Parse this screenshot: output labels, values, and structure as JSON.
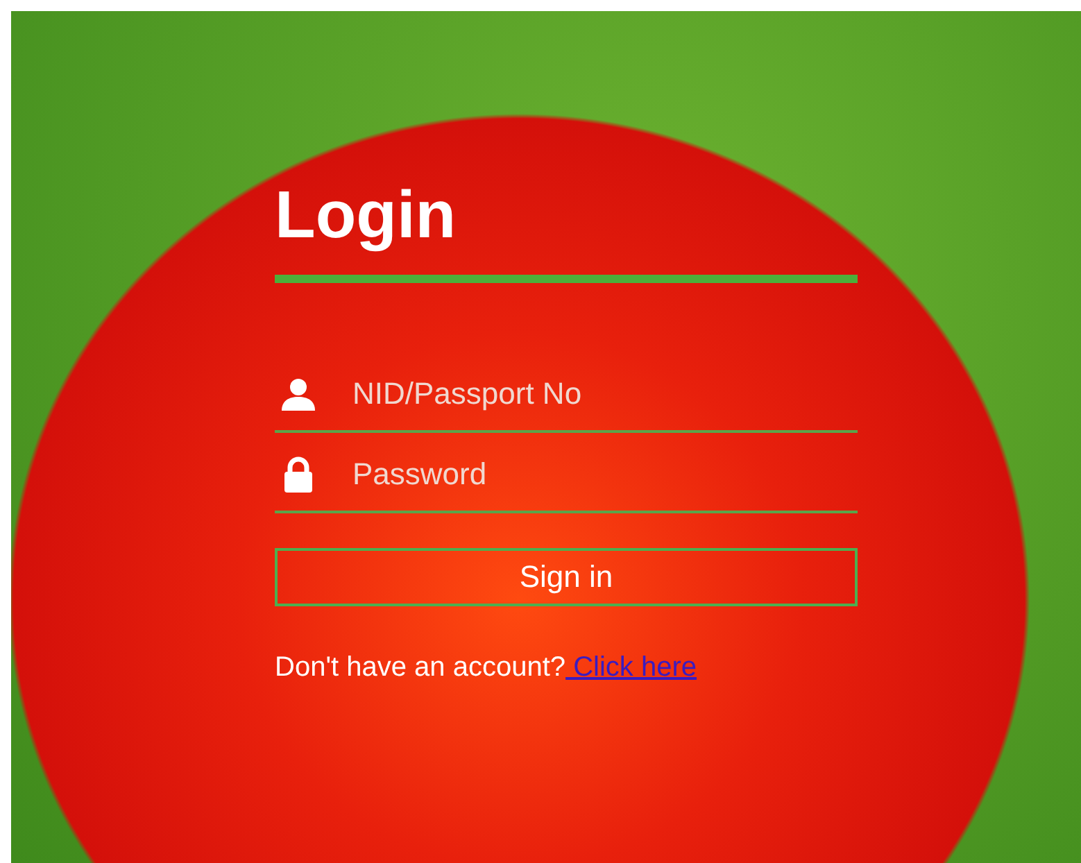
{
  "title": "Login",
  "fields": [
    {
      "kind": "user",
      "placeholder": "NID/Passport No"
    },
    {
      "kind": "password",
      "placeholder": "Password"
    }
  ],
  "submit_button": "Sign in",
  "signup_prompt": {
    "text": "Don't have an account?",
    "link": " Click here"
  }
}
